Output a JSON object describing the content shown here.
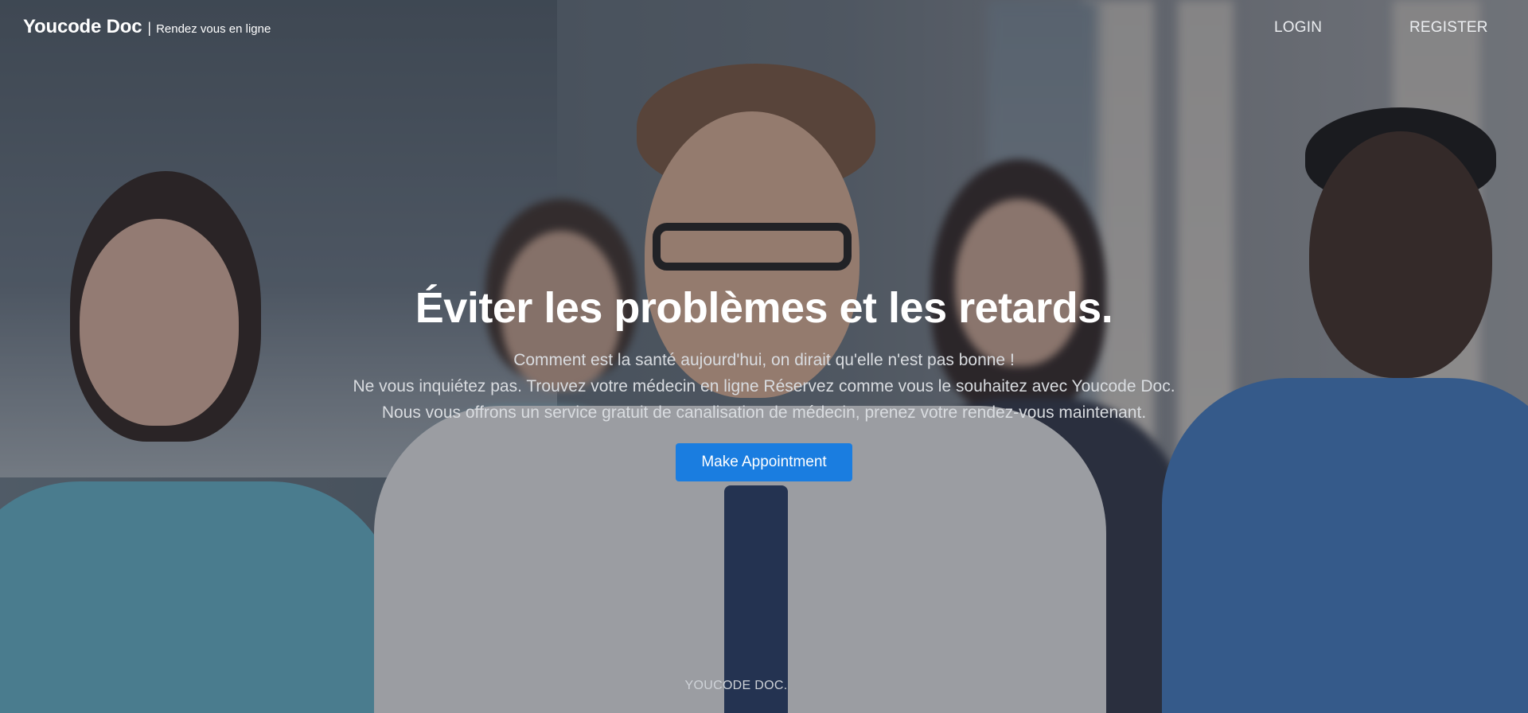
{
  "brand": {
    "name": "Youcode Doc",
    "separator": "|",
    "tagline": "Rendez vous en ligne"
  },
  "nav": {
    "login": "LOGIN",
    "register": "REGISTER"
  },
  "hero": {
    "headline": "Éviter les problèmes et les retards.",
    "lines": [
      "Comment est la santé aujourd'hui, on dirait qu'elle n'est pas bonne !",
      "Ne vous inquiétez pas. Trouvez votre médecin en ligne Réservez comme vous le souhaitez avec Youcode Doc.",
      "Nous vous offrons un service gratuit de canalisation de médecin, prenez votre rendez-vous maintenant."
    ],
    "cta_label": "Make Appointment"
  },
  "footer": {
    "mark": "YOUCODE DOC."
  },
  "colors": {
    "accent": "#1a7de0",
    "text": "#ffffff"
  }
}
